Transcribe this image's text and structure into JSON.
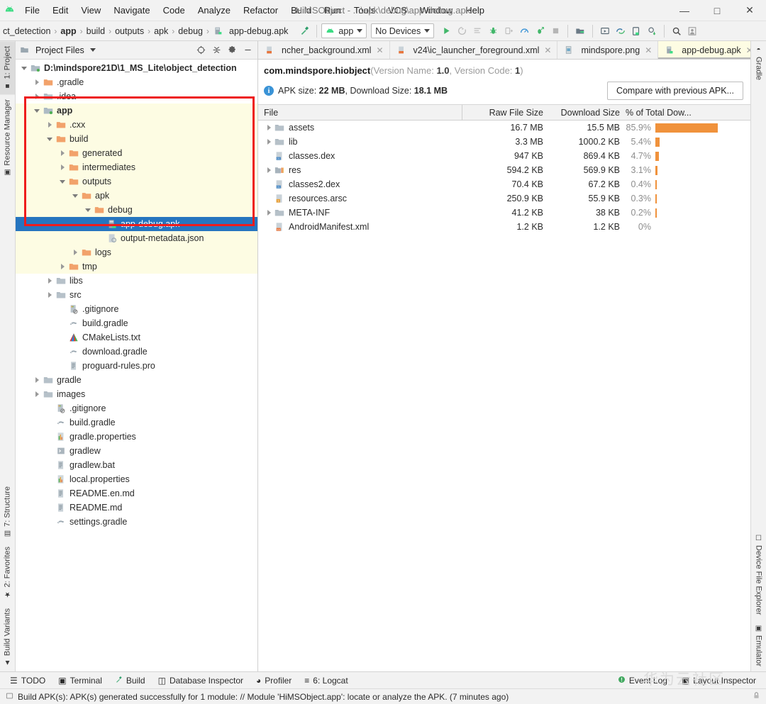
{
  "window": {
    "title": "HiMSObject - ...\\apk\\debug\\app-debug.apk",
    "minimize": "—",
    "maximize": "□",
    "close": "✕"
  },
  "menu": [
    "File",
    "Edit",
    "View",
    "Navigate",
    "Code",
    "Analyze",
    "Refactor",
    "Build",
    "Run",
    "Tools",
    "VCS",
    "Window",
    "Help"
  ],
  "toolbar": {
    "breadcrumbs": [
      "ct_detection",
      "app",
      "build",
      "outputs",
      "apk",
      "debug",
      "app-debug.apk"
    ],
    "breadcrumb_bold_index": 1,
    "run_config": "app",
    "device": "No Devices",
    "separator": "›"
  },
  "project_panel": {
    "title": "Project Files",
    "tree": [
      {
        "label": "D:\\mindspore21D\\1_MS_Lite\\object_detection",
        "depth": 0,
        "arrow": "open",
        "icon": "module-folder",
        "bold": true,
        "highlight": false,
        "selected": false
      },
      {
        "label": ".gradle",
        "depth": 1,
        "arrow": "closed",
        "icon": "folder-orange",
        "bold": false,
        "highlight": false,
        "selected": false
      },
      {
        "label": ".idea",
        "depth": 1,
        "arrow": "closed",
        "icon": "folder-gray",
        "bold": false,
        "highlight": false,
        "selected": false
      },
      {
        "label": "app",
        "depth": 1,
        "arrow": "open",
        "icon": "module-folder",
        "bold": true,
        "highlight": true,
        "selected": false
      },
      {
        "label": ".cxx",
        "depth": 2,
        "arrow": "closed",
        "icon": "folder-orange",
        "bold": false,
        "highlight": true,
        "selected": false
      },
      {
        "label": "build",
        "depth": 2,
        "arrow": "open",
        "icon": "folder-orange",
        "bold": false,
        "highlight": true,
        "selected": false
      },
      {
        "label": "generated",
        "depth": 3,
        "arrow": "closed",
        "icon": "folder-orange",
        "bold": false,
        "highlight": true,
        "selected": false
      },
      {
        "label": "intermediates",
        "depth": 3,
        "arrow": "closed",
        "icon": "folder-orange",
        "bold": false,
        "highlight": true,
        "selected": false
      },
      {
        "label": "outputs",
        "depth": 3,
        "arrow": "open",
        "icon": "folder-orange",
        "bold": false,
        "highlight": true,
        "selected": false
      },
      {
        "label": "apk",
        "depth": 4,
        "arrow": "open",
        "icon": "folder-orange",
        "bold": false,
        "highlight": true,
        "selected": false
      },
      {
        "label": "debug",
        "depth": 5,
        "arrow": "open",
        "icon": "folder-orange",
        "bold": false,
        "highlight": true,
        "selected": false
      },
      {
        "label": "app-debug.apk",
        "depth": 6,
        "arrow": "none",
        "icon": "apk-file",
        "bold": false,
        "highlight": false,
        "selected": true
      },
      {
        "label": "output-metadata.json",
        "depth": 6,
        "arrow": "none",
        "icon": "json-file",
        "bold": false,
        "highlight": true,
        "selected": false
      },
      {
        "label": "logs",
        "depth": 4,
        "arrow": "closed",
        "icon": "folder-orange",
        "bold": false,
        "highlight": true,
        "selected": false
      },
      {
        "label": "tmp",
        "depth": 3,
        "arrow": "closed",
        "icon": "folder-orange",
        "bold": false,
        "highlight": true,
        "selected": false
      },
      {
        "label": "libs",
        "depth": 2,
        "arrow": "closed",
        "icon": "folder-gray",
        "bold": false,
        "highlight": false,
        "selected": false
      },
      {
        "label": "src",
        "depth": 2,
        "arrow": "closed",
        "icon": "folder-gray",
        "bold": false,
        "highlight": false,
        "selected": false
      },
      {
        "label": ".gitignore",
        "depth": 3,
        "arrow": "none",
        "icon": "gitignore-file",
        "bold": false,
        "highlight": false,
        "selected": false
      },
      {
        "label": "build.gradle",
        "depth": 3,
        "arrow": "none",
        "icon": "gradle-file",
        "bold": false,
        "highlight": false,
        "selected": false
      },
      {
        "label": "CMakeLists.txt",
        "depth": 3,
        "arrow": "none",
        "icon": "cmake-file",
        "bold": false,
        "highlight": false,
        "selected": false
      },
      {
        "label": "download.gradle",
        "depth": 3,
        "arrow": "none",
        "icon": "gradle-file",
        "bold": false,
        "highlight": false,
        "selected": false
      },
      {
        "label": "proguard-rules.pro",
        "depth": 3,
        "arrow": "none",
        "icon": "text-file",
        "bold": false,
        "highlight": false,
        "selected": false
      },
      {
        "label": "gradle",
        "depth": 1,
        "arrow": "closed",
        "icon": "folder-gray",
        "bold": false,
        "highlight": false,
        "selected": false
      },
      {
        "label": "images",
        "depth": 1,
        "arrow": "closed",
        "icon": "folder-gray",
        "bold": false,
        "highlight": false,
        "selected": false
      },
      {
        "label": ".gitignore",
        "depth": 2,
        "arrow": "none",
        "icon": "gitignore-file",
        "bold": false,
        "highlight": false,
        "selected": false
      },
      {
        "label": "build.gradle",
        "depth": 2,
        "arrow": "none",
        "icon": "gradle-file",
        "bold": false,
        "highlight": false,
        "selected": false
      },
      {
        "label": "gradle.properties",
        "depth": 2,
        "arrow": "none",
        "icon": "properties-file",
        "bold": false,
        "highlight": false,
        "selected": false
      },
      {
        "label": "gradlew",
        "depth": 2,
        "arrow": "none",
        "icon": "script-file",
        "bold": false,
        "highlight": false,
        "selected": false
      },
      {
        "label": "gradlew.bat",
        "depth": 2,
        "arrow": "none",
        "icon": "text-file",
        "bold": false,
        "highlight": false,
        "selected": false
      },
      {
        "label": "local.properties",
        "depth": 2,
        "arrow": "none",
        "icon": "properties-file",
        "bold": false,
        "highlight": false,
        "selected": false
      },
      {
        "label": "README.en.md",
        "depth": 2,
        "arrow": "none",
        "icon": "text-file",
        "bold": false,
        "highlight": false,
        "selected": false
      },
      {
        "label": "README.md",
        "depth": 2,
        "arrow": "none",
        "icon": "text-file",
        "bold": false,
        "highlight": false,
        "selected": false
      },
      {
        "label": "settings.gradle",
        "depth": 2,
        "arrow": "none",
        "icon": "gradle-file",
        "bold": false,
        "highlight": false,
        "selected": false
      }
    ]
  },
  "editor_tabs": [
    {
      "label": "ncher_background.xml",
      "icon": "xml-file",
      "active": false
    },
    {
      "label": "v24\\ic_launcher_foreground.xml",
      "icon": "xml-res-file",
      "active": false
    },
    {
      "label": "mindspore.png",
      "icon": "image-file",
      "active": false
    },
    {
      "label": "app-debug.apk",
      "icon": "apk-file",
      "active": true
    }
  ],
  "apk_analyzer": {
    "package": "com.mindspore.hiobject",
    "version_prefix": "(Version Name: ",
    "version_name": "1.0",
    "version_mid": ", Version Code: ",
    "version_code": "1",
    "version_suffix": ")",
    "apk_size_label": "APK size: ",
    "apk_size": "22 MB",
    "download_size_label": ", Download Size: ",
    "download_size": "18.1 MB",
    "compare_button": "Compare with previous APK...",
    "columns": [
      "File",
      "Raw File Size",
      "Download Size",
      "% of Total Dow..."
    ],
    "rows": [
      {
        "name": "assets",
        "icon": "folder-gray",
        "expandable": true,
        "raw": "16.7 MB",
        "download": "15.5 MB",
        "percent": "85.9%",
        "percent_value": 85.9
      },
      {
        "name": "lib",
        "icon": "folder-gray",
        "expandable": true,
        "raw": "3.3 MB",
        "download": "1000.2 KB",
        "percent": "5.4%",
        "percent_value": 5.4
      },
      {
        "name": "classes.dex",
        "icon": "dex-file",
        "expandable": false,
        "raw": "947 KB",
        "download": "869.4 KB",
        "percent": "4.7%",
        "percent_value": 4.7
      },
      {
        "name": "res",
        "icon": "res-folder",
        "expandable": true,
        "raw": "594.2 KB",
        "download": "569.9 KB",
        "percent": "3.1%",
        "percent_value": 3.1
      },
      {
        "name": "classes2.dex",
        "icon": "dex-file",
        "expandable": false,
        "raw": "70.4 KB",
        "download": "67.2 KB",
        "percent": "0.4%",
        "percent_value": 0.4
      },
      {
        "name": "resources.arsc",
        "icon": "arsc-file",
        "expandable": false,
        "raw": "250.9 KB",
        "download": "55.9 KB",
        "percent": "0.3%",
        "percent_value": 0.3
      },
      {
        "name": "META-INF",
        "icon": "folder-gray",
        "expandable": true,
        "raw": "41.2 KB",
        "download": "38 KB",
        "percent": "0.2%",
        "percent_value": 0.2
      },
      {
        "name": "AndroidManifest.xml",
        "icon": "manifest-file",
        "expandable": false,
        "raw": "1.2 KB",
        "download": "1.2 KB",
        "percent": "0%",
        "percent_value": 0
      }
    ],
    "bar_color": "#f0923c"
  },
  "left_strip": {
    "top": [
      {
        "label": "1: Project",
        "icon": "project-icon",
        "active": true
      },
      {
        "label": "Resource Manager",
        "icon": "resource-icon",
        "active": false
      }
    ],
    "bottom": [
      {
        "label": "7: Structure",
        "icon": "structure-icon",
        "active": false
      },
      {
        "label": "2: Favorites",
        "icon": "star-icon",
        "active": false
      },
      {
        "label": "Build Variants",
        "icon": "variants-icon",
        "active": false
      }
    ]
  },
  "right_strip": {
    "top": [
      {
        "label": "Gradle",
        "icon": "gradle-icon",
        "active": false
      }
    ],
    "bottom": [
      {
        "label": "Device File Explorer",
        "icon": "device-icon",
        "active": false
      },
      {
        "label": "Emulator",
        "icon": "emulator-icon",
        "active": false
      }
    ]
  },
  "bottom_tools": [
    {
      "label": "TODO",
      "icon": "todo-icon"
    },
    {
      "label": "Terminal",
      "icon": "terminal-icon"
    },
    {
      "label": "Build",
      "icon": "build-hammer-icon"
    },
    {
      "label": "Database Inspector",
      "icon": "database-icon"
    },
    {
      "label": "Profiler",
      "icon": "profiler-icon"
    },
    {
      "label": "6: Logcat",
      "icon": "logcat-icon"
    }
  ],
  "bottom_right_tools": [
    {
      "label": "Event Log",
      "icon": "event-log-icon"
    },
    {
      "label": "Layout Inspector",
      "icon": "layout-inspector-icon"
    }
  ],
  "status_bar": {
    "message": "Build APK(s): APK(s) generated successfully for 1 module: // Module 'HiMSObject.app': locate or analyze the APK. (7 minutes ago)",
    "icon": "message-icon",
    "lock": "🔒"
  },
  "watermark": "华为云社区",
  "annotation": {
    "color": "#ee1c1c",
    "shape": "rectangle"
  }
}
